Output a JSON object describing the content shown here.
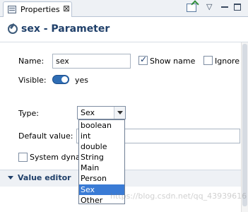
{
  "tab": {
    "label": "Properties",
    "close_glyph": "⊠"
  },
  "toolbar": {
    "menu_glyph": "▽",
    "icons": [
      "new-property-icon",
      "view-menu-icon",
      "minimize-icon",
      "maximize-icon"
    ]
  },
  "title": "sex - Parameter",
  "form": {
    "name_label": "Name:",
    "name_value": "sex",
    "show_name_label": "Show name",
    "show_name_checked": true,
    "ignore_label": "Ignore",
    "ignore_checked": false,
    "visible_label": "Visible:",
    "visible_value": "yes",
    "type_label": "Type:",
    "type_value": "Sex",
    "type_options": [
      "boolean",
      "int",
      "double",
      "String",
      "Main",
      "Person",
      "Sex",
      "Other"
    ],
    "type_selected_index": 6,
    "default_value_label": "Default value:",
    "default_value": "",
    "system_dyna_label": "System dyna",
    "system_dyna_checked": false
  },
  "section": {
    "label": "Value editor"
  },
  "watermark": "https://blog.csdn.net/qq_43939616",
  "colors": {
    "accent": "#3a7bd5",
    "title": "#20406a",
    "toggle": "#2e6db4"
  }
}
